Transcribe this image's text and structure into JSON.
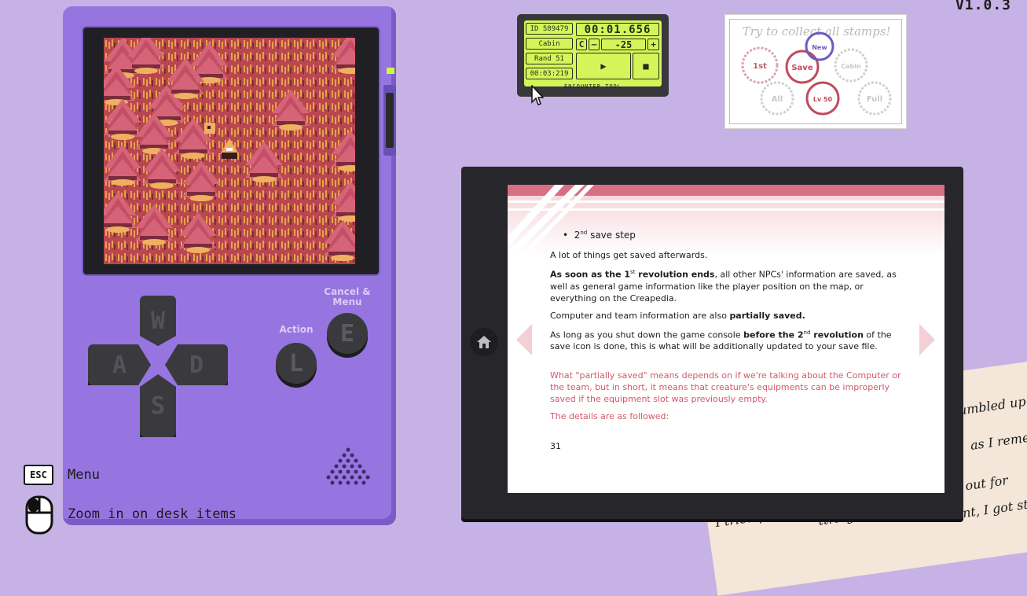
{
  "version": "V1.0.3",
  "console": {
    "keys": {
      "up": "W",
      "left": "A",
      "down": "S",
      "right": "D"
    },
    "action_label": "Action",
    "action_key": "L",
    "cancel_label_line1": "Cancel &",
    "cancel_label_line2": "Menu",
    "cancel_key": "E"
  },
  "hints": {
    "esc_key": "ESC",
    "esc_action": "Menu",
    "mouse_action": "Zoom in on desk items"
  },
  "encounter_tool": {
    "id": "ID 589479",
    "location": "Cabin",
    "rand": "Rand 51",
    "elapsed": "00:03:219",
    "timer": "00:01.656",
    "c_button": "C",
    "minus_button": "–",
    "value": "-25",
    "plus_button": "+",
    "play_symbol": "▶",
    "stop_symbol": "■",
    "name": "ENCOUNTER TOOL"
  },
  "stamps": {
    "title": "Try to collect all stamps!",
    "items": [
      "1st",
      "Save",
      "New",
      "Cabin",
      "All",
      "Lv 50",
      "Full"
    ]
  },
  "tablet": {
    "bullet_main": "2",
    "bullet_sup": "nd",
    "bullet_rest": " save step",
    "p1": "A lot of things get saved afterwards.",
    "p2_b1": "As soon as the 1",
    "p2_sup": "st",
    "p2_b2": " revolution ends",
    "p2_rest": ", all other NPCs' information are saved, as well as general game information like the player position on the map, or everything on the Creapedia.",
    "p3_a": "Computer and team information are also ",
    "p3_b": "partially saved.",
    "p4_a": "As long as you shut down the game console ",
    "p4_b1": "before the 2",
    "p4_sup": "nd",
    "p4_b2": " revolution",
    "p4_c": " of the save icon is done, this is what will be additionally updated to your save file.",
    "red1": "What \"partially saved\" means depends on if we're talking about the Computer or the team, but in short, it means that creature's equipments can be improperly saved if the equipment slot was previously empty.",
    "red2": "The details are as followed:",
    "page": "31"
  },
  "note": {
    "line1": "tumbled up",
    "line2": "as I remem",
    "line3": "t out for",
    "line4": "I tried pla",
    "line5": "ttridge, feel free to",
    "line6": "want, I got stuck i"
  }
}
